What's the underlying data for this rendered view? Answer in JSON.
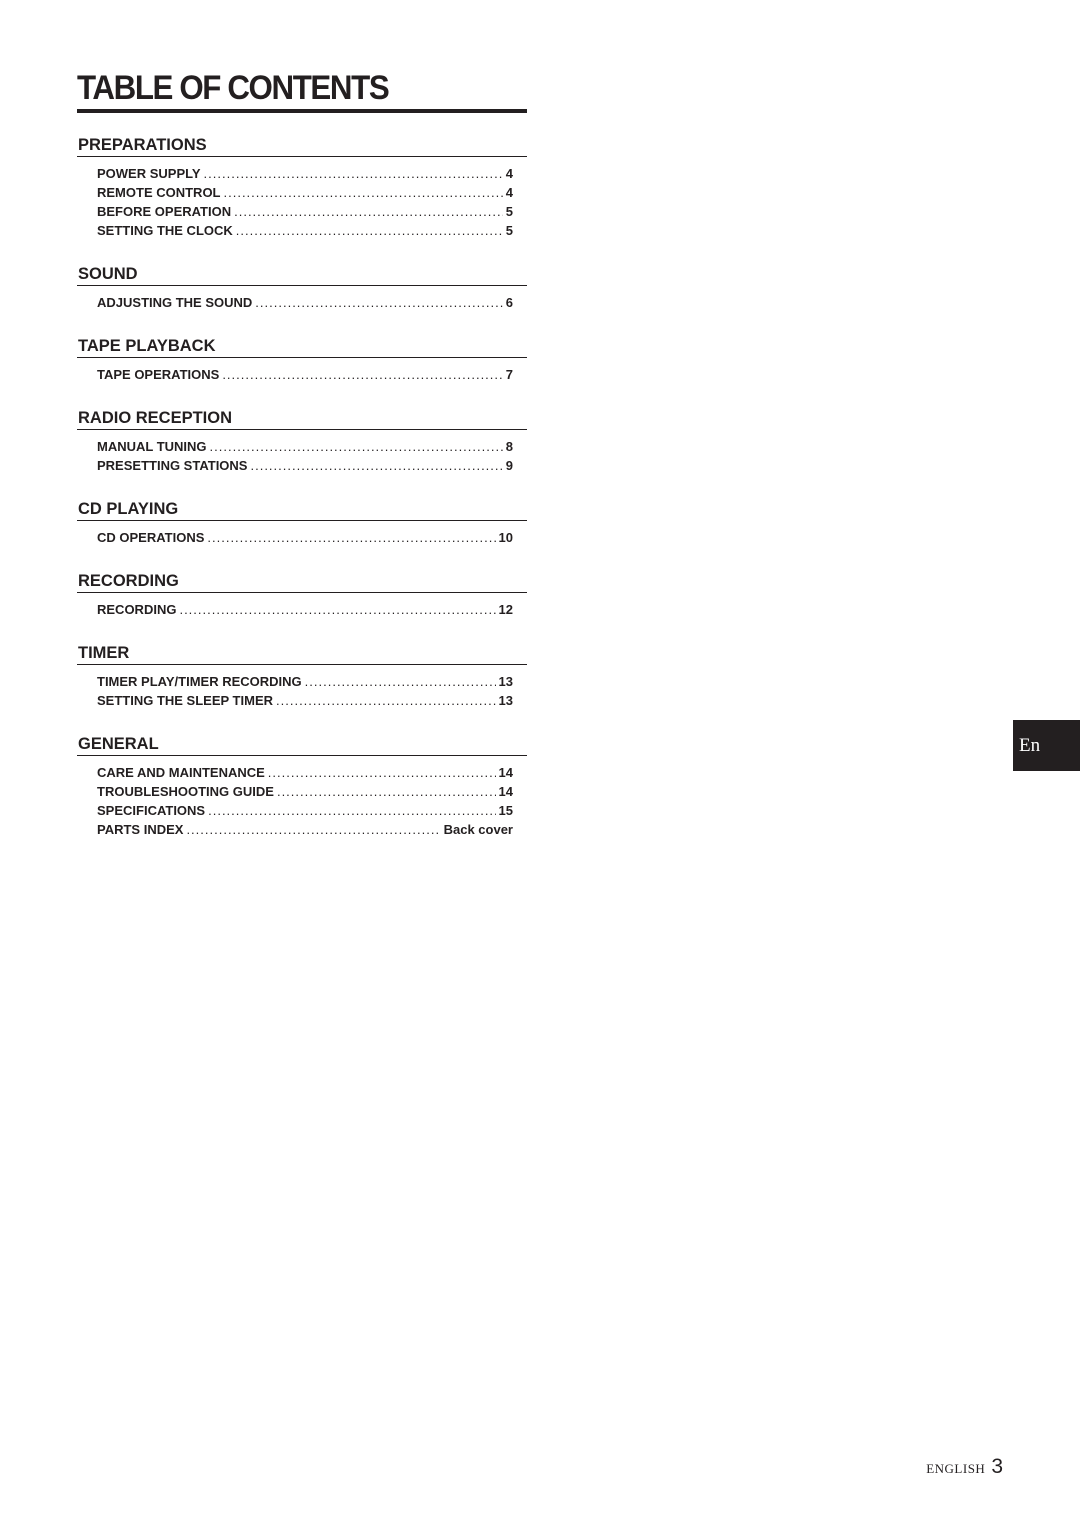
{
  "title": "TABLE OF CONTENTS",
  "sections": [
    {
      "heading": "PREPARATIONS",
      "entries": [
        {
          "label": "POWER SUPPLY",
          "page": "4"
        },
        {
          "label": "REMOTE CONTROL",
          "page": "4"
        },
        {
          "label": "BEFORE OPERATION",
          "page": "5"
        },
        {
          "label": "SETTING THE CLOCK",
          "page": "5"
        }
      ]
    },
    {
      "heading": "SOUND",
      "entries": [
        {
          "label": "ADJUSTING THE SOUND",
          "page": "6"
        }
      ]
    },
    {
      "heading": "TAPE PLAYBACK",
      "entries": [
        {
          "label": "TAPE OPERATIONS",
          "page": "7"
        }
      ]
    },
    {
      "heading": "RADIO RECEPTION",
      "entries": [
        {
          "label": "MANUAL TUNING",
          "page": "8"
        },
        {
          "label": "PRESETTING STATIONS",
          "page": "9"
        }
      ]
    },
    {
      "heading": "CD PLAYING",
      "entries": [
        {
          "label": "CD OPERATIONS",
          "page": "10"
        }
      ]
    },
    {
      "heading": "RECORDING",
      "entries": [
        {
          "label": "RECORDING",
          "page": "12"
        }
      ]
    },
    {
      "heading": "TIMER",
      "entries": [
        {
          "label": "TIMER PLAY/TIMER RECORDING",
          "page": "13"
        },
        {
          "label": "SETTING THE SLEEP TIMER",
          "page": "13"
        }
      ]
    },
    {
      "heading": "GENERAL",
      "entries": [
        {
          "label": "CARE AND MAINTENANCE",
          "page": "14"
        },
        {
          "label": "TROUBLESHOOTING GUIDE",
          "page": "14"
        },
        {
          "label": "SPECIFICATIONS",
          "page": "15"
        },
        {
          "label": "PARTS INDEX",
          "page": "Back cover"
        }
      ]
    }
  ],
  "language_tab": "En",
  "footer": {
    "language": "ENGLISH",
    "page_number": "3"
  }
}
